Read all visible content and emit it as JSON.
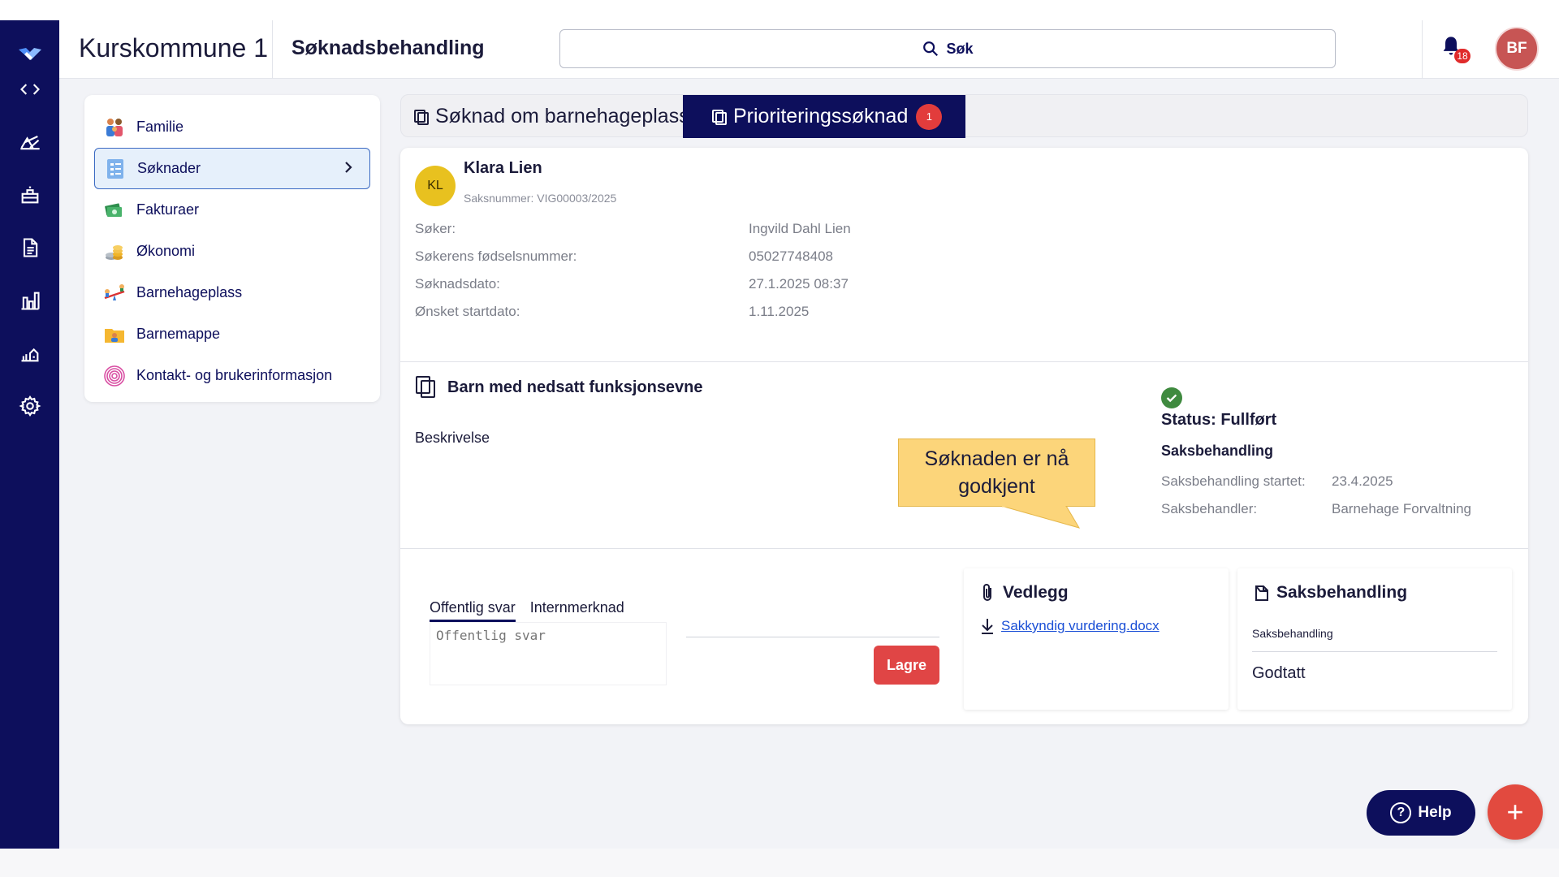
{
  "app": {
    "brand": "Kurskommune 1",
    "section": "Søknadsbehandling",
    "search_label": "Søk",
    "notifications_count": "18",
    "user_initials": "BF"
  },
  "sidebar": {
    "items": [
      {
        "label": "Familie",
        "icon": "family-icon"
      },
      {
        "label": "Søknader",
        "icon": "document-list-icon",
        "active": true
      },
      {
        "label": "Fakturaer",
        "icon": "cash-icon"
      },
      {
        "label": "Økonomi",
        "icon": "coins-icon"
      },
      {
        "label": "Barnehageplass",
        "icon": "seesaw-icon"
      },
      {
        "label": "Barnemappe",
        "icon": "folder-child-icon"
      },
      {
        "label": "Kontakt- og brukerinformasjon",
        "icon": "fingerprint-icon"
      }
    ]
  },
  "tabs": {
    "tab1": "Søknad om barnehageplass",
    "tab2": "Prioriteringssøknad",
    "tab2_badge": "1"
  },
  "applicant": {
    "initials": "KL",
    "name": "Klara Lien",
    "saksnummer": "Saksnummer: VIG00003/2025",
    "fields": [
      {
        "label": "Søker:",
        "value": "Ingvild Dahl Lien"
      },
      {
        "label": "Søkerens fødselsnummer:",
        "value": "05027748408"
      },
      {
        "label": "Søknadsdato:",
        "value": "27.1.2025 08:37"
      },
      {
        "label": "Ønsket startdato:",
        "value": "1.11.2025"
      }
    ]
  },
  "priority": {
    "title": "Barn med nedsatt funksjonsevne",
    "description_label": "Beskrivelse",
    "callout": "Søknaden er nå godkjent",
    "status": "Status: Fullført",
    "saksbehandling_title": "Saksbehandling",
    "details": [
      {
        "label": "Saksbehandling startet:",
        "value": "23.4.2025"
      },
      {
        "label": "Saksbehandler:",
        "value": "Barnehage Forvaltning"
      }
    ]
  },
  "reply": {
    "tab_public": "Offentlig svar",
    "tab_internal": "Internmerknad",
    "placeholder": "Offentlig svar",
    "save_label": "Lagre"
  },
  "vedlegg": {
    "title": "Vedlegg",
    "file": "Sakkyndig vurdering.docx"
  },
  "saksbehandling_panel": {
    "title": "Saksbehandling",
    "field_label": "Saksbehandling",
    "value": "Godtatt"
  },
  "fab": {
    "help_label": "Help",
    "add_label": "+"
  },
  "colors": {
    "navy": "#0d0f5c",
    "accent_red": "#e04545",
    "callout": "#fcd57a",
    "status_green": "#3f8a3f"
  }
}
